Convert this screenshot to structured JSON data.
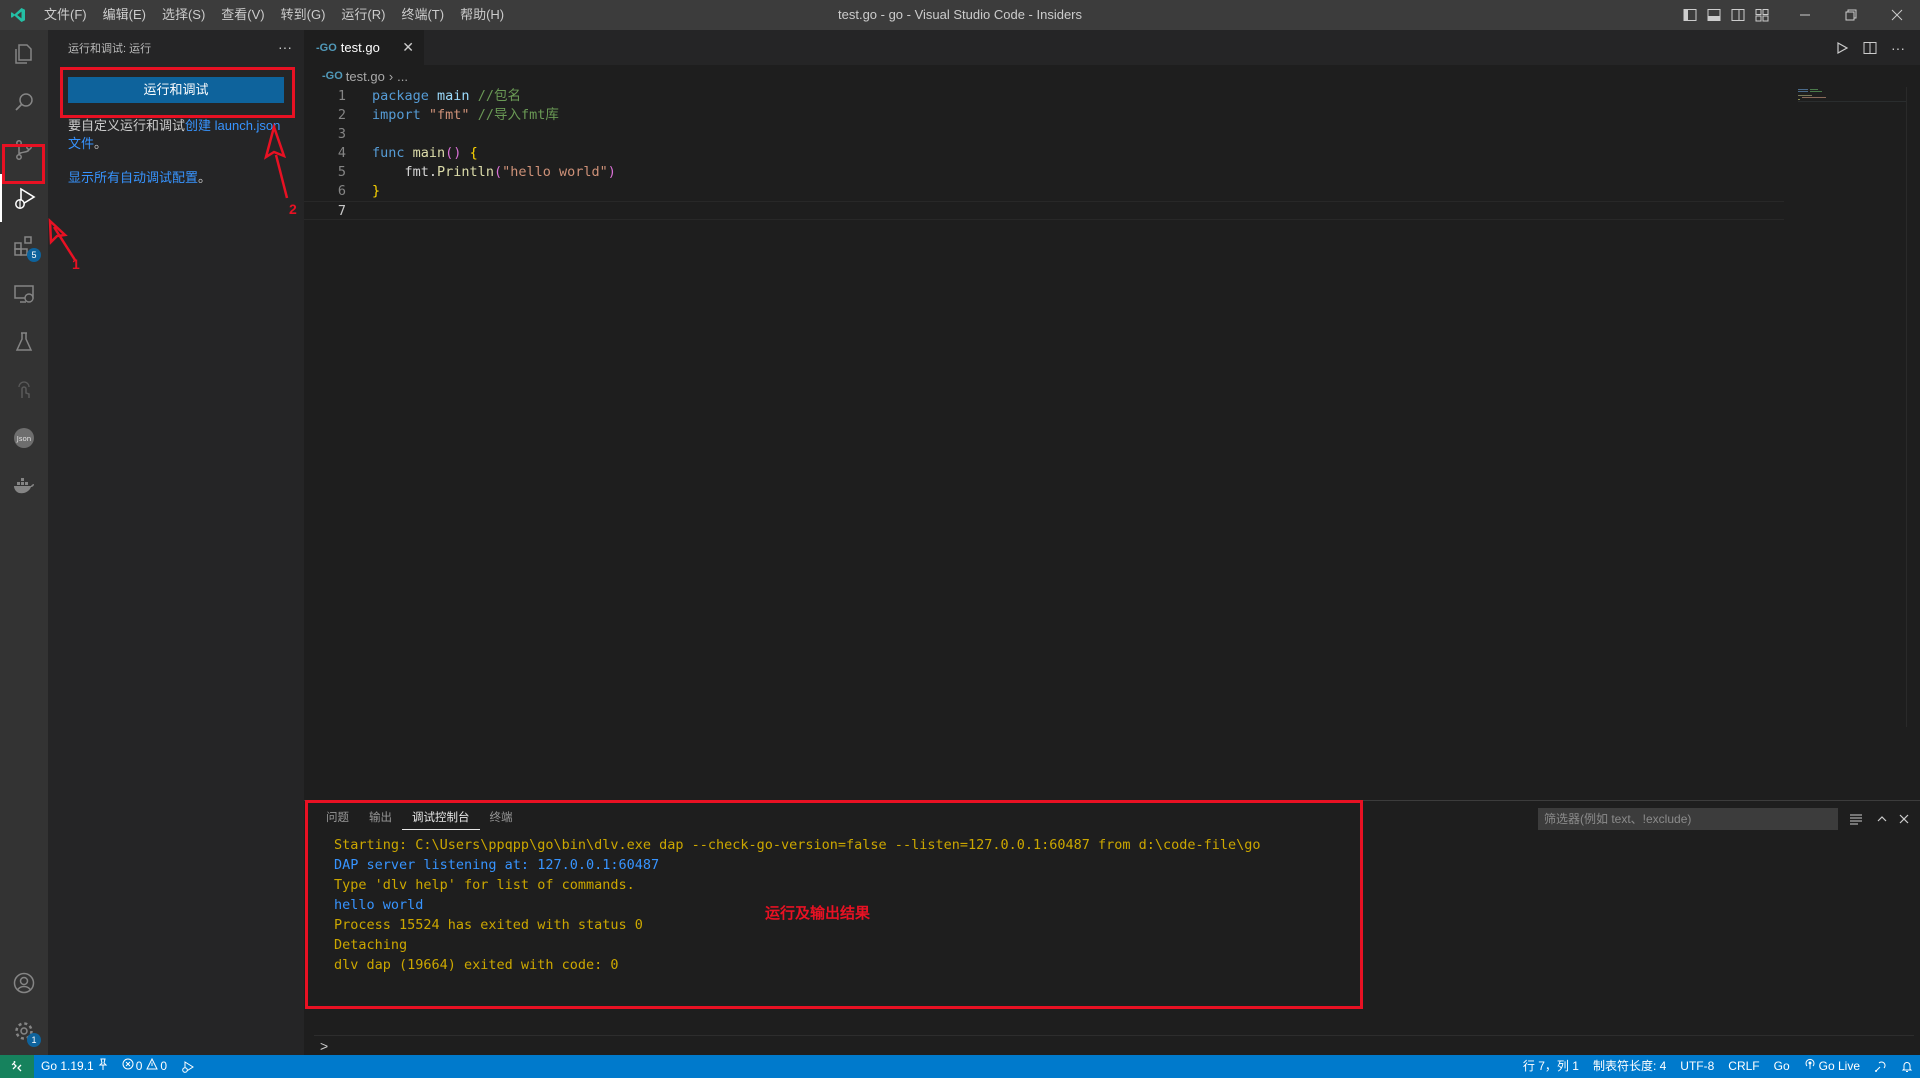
{
  "titlebar": {
    "menu": [
      "文件(F)",
      "编辑(E)",
      "选择(S)",
      "查看(V)",
      "转到(G)",
      "运行(R)",
      "终端(T)",
      "帮助(H)"
    ],
    "window_title": "test.go - go - Visual Studio Code - Insiders"
  },
  "activitybar": {
    "extensions_badge": "5",
    "manage_badge": "1",
    "icons": [
      "explorer-icon",
      "search-icon",
      "source-control-icon",
      "run-debug-icon",
      "extensions-icon",
      "remote-explorer-icon",
      "testing-icon",
      "go-live-icon",
      "json-icon",
      "docker-icon",
      "account-icon",
      "manage-gear-icon"
    ]
  },
  "sidebar": {
    "header": "运行和调试: 运行",
    "more": "···",
    "run_button": "运行和调试",
    "desc_prefix": "要自定义运行和调试",
    "desc_link": "创建 launch.json",
    "desc_suffix_link": "文件",
    "desc_end": "。",
    "show_all_link": "显示所有自动调试配置",
    "show_all_end": "。"
  },
  "editor": {
    "tab_icon": "-GO",
    "tab_label": "test.go",
    "breadcrumb_file": "test.go",
    "breadcrumb_rest": "...",
    "line_numbers": [
      "1",
      "2",
      "3",
      "4",
      "5",
      "6",
      "7"
    ],
    "code": {
      "l1_kw": "package",
      "l1_ident": "main",
      "l1_cmt": "//包名",
      "l2_kw": "import",
      "l2_str": "\"fmt\"",
      "l2_cmt": "//导入fmt库",
      "l4_kw": "func",
      "l4_fn": "main",
      "l4_parens": "()",
      "l4_brace": "{",
      "l5_pkg": "fmt",
      "l5_dot": ".",
      "l5_fn": "Println",
      "l5_lp": "(",
      "l5_str": "\"hello world\"",
      "l5_rp": ")",
      "l6_brace": "}"
    }
  },
  "panel": {
    "tabs": [
      "问题",
      "输出",
      "调试控制台",
      "终端"
    ],
    "active_tab": "调试控制台",
    "filter_placeholder": "筛选器(例如 text、!exclude)",
    "console": [
      {
        "text": "Starting: C:\\Users\\ppqpp\\go\\bin\\dlv.exe dap --check-go-version=false --listen=127.0.0.1:60487 from d:\\code-file\\go",
        "color": "yellow"
      },
      {
        "text": "DAP server listening at: 127.0.0.1:60487",
        "color": "blue"
      },
      {
        "text": "Type 'dlv help' for list of commands.",
        "color": "yellow"
      },
      {
        "text": "hello world",
        "color": "blue"
      },
      {
        "text": "Process 15524 has exited with status 0",
        "color": "yellow"
      },
      {
        "text": "Detaching",
        "color": "yellow"
      },
      {
        "text": "dlv dap (19664) exited with code: 0",
        "color": "yellow"
      }
    ],
    "prompt": ">"
  },
  "statusbar": {
    "go_version": "Go 1.19.1",
    "errors": "0",
    "warnings": "0",
    "cursor": "行 7，列 1",
    "tab_size": "制表符长度: 4",
    "encoding": "UTF-8",
    "eol": "CRLF",
    "language": "Go",
    "go_live": "Go Live"
  },
  "annotations": {
    "label_1": "1",
    "label_2": "2",
    "result_label": "运行及输出结果",
    "color": "#e81123"
  },
  "colors": {
    "accent": "#007acc",
    "button": "#0e639c",
    "link": "#3794ff",
    "remote": "#16825d"
  }
}
